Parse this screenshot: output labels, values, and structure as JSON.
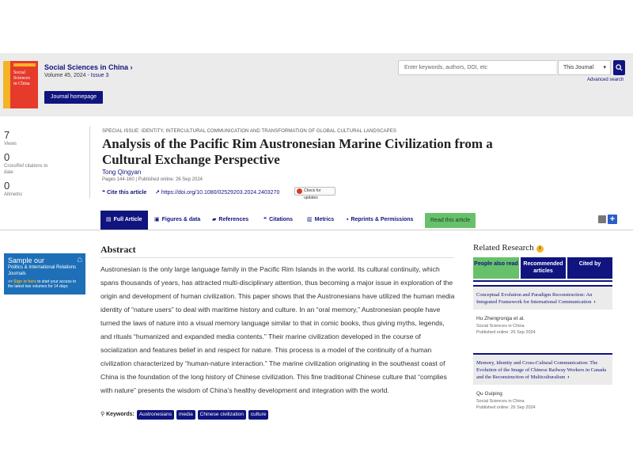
{
  "journal": {
    "cover_text": [
      "Social",
      "Sciences",
      "in China"
    ],
    "title": "Social Sciences in China ›",
    "volume": "Volume 45, 2024 -",
    "issue": "Issue 3",
    "homepage_label": "Journal homepage"
  },
  "search": {
    "placeholder": "Enter keywords, authors, DOI, etc",
    "scope": "This Journal",
    "advanced_label": "Advanced search",
    "accent": "#10147e"
  },
  "metrics": [
    {
      "value": "7",
      "label": "Views"
    },
    {
      "value": "0",
      "label": "CrossRef citations to date"
    },
    {
      "value": "0",
      "label": "Altmetric"
    }
  ],
  "article": {
    "special_issue": "SPECIAL ISSUE: IDENTITY, INTERCULTURAL COMMUNICATION AND TRANSFORMATION OF GLOBAL CULTURAL LANDSCAPES",
    "title": "Analysis of the Pacific Rim Austronesian Marine Civilization from a Cultural Exchange Perspective",
    "author": "Tong Qingyan",
    "pages": "Pages 144-160 | Published online: 26 Sep 2024",
    "cite_label": "Cite this article",
    "doi": "https://doi.org/10.1080/02529203.2024.2403270",
    "updates_label": "Check for updates"
  },
  "tabs": {
    "full_article": "Full Article",
    "figures": "Figures & data",
    "references": "References",
    "citations": "Citations",
    "metrics": "Metrics",
    "reprints": "Reprints & Permissions",
    "read": "Read this article"
  },
  "promo": {
    "line1": "Sample our",
    "line2": "Politics & International Relations Journals",
    "cta_prefix": ">>",
    "cta_link": "Sign in here",
    "cta_rest": "to start your access to the latest two volumes for 14 days"
  },
  "abstract": {
    "heading": "Abstract",
    "text": "Austronesian is the only large language family in the Pacific Rim Islands in the world. Its cultural continuity, which spans thousands of years, has attracted multi-disciplinary attention, thus becoming a major issue in exploration of the origin and development of human civilization. This paper shows that the Austronesians have utilized the human media identity of “nature users” to deal with maritime history and culture. In an “oral memory,” Austronesian people have turned the laws of nature into a visual memory language similar to that in comic books, thus giving myths, legends, and rituals “humanized and expanded media contents.” Their marine civilization developed in the course of socialization and features belief in and respect for nature. This process is a model of the continuity of a human civilization characterized by “human-nature interaction.” The marine civilization originating in the southeast coast of China is the foundation of the long history of Chinese civilization. This fine traditional Chinese culture that “complies with nature” presents the wisdom of China’s healthy development and integration with the world."
  },
  "keywords": {
    "label": "Keywords:",
    "items": [
      "Austronesians",
      "media",
      "Chinese civilization",
      "culture"
    ]
  },
  "related": {
    "heading": "Related Research",
    "tabs": [
      "People also read",
      "Recommended articles",
      "Cited by"
    ],
    "articles": [
      {
        "title": "Conceptual Evolution and Paradigm Reconstruction: An Integrated Framework for International Communication",
        "author": "Hu Zhengronga et al.",
        "journal": "Social Sciences in China",
        "published": "Published online: 26 Sep 2024"
      },
      {
        "title": "Memory, Identity and Cross-Cultural Communication: The Evolution of the Image of Chinese Railway Workers in Canada and the Reconstruction of Multiculturalism",
        "author": "Qu Guiping",
        "journal": "Social Sciences in China",
        "published": "Published online: 26 Sep 2024"
      }
    ]
  }
}
